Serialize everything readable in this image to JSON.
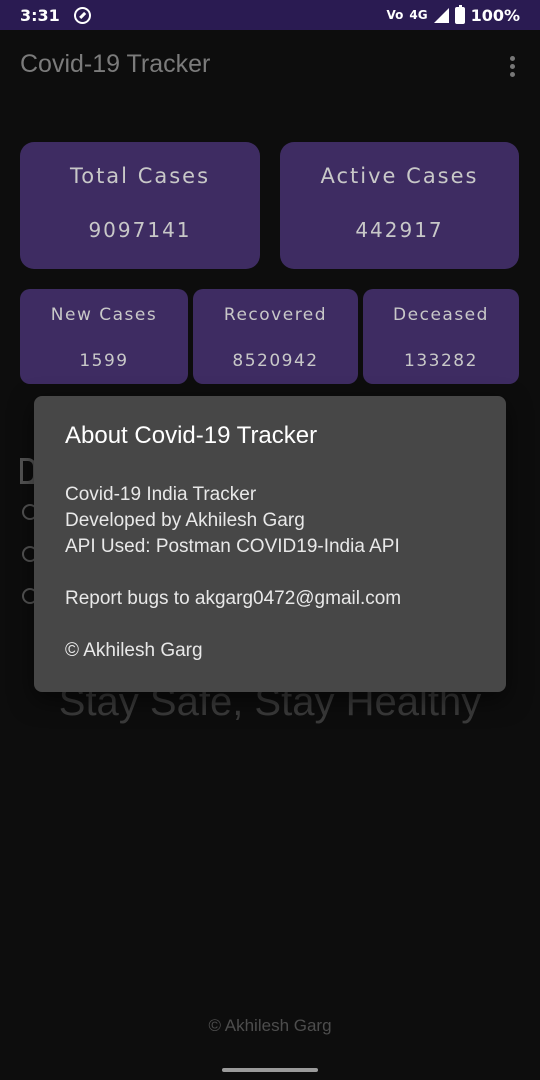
{
  "status_bar": {
    "time": "3:31",
    "volte": "Vo",
    "network": "4G",
    "battery": "100%"
  },
  "app_bar": {
    "title": "Covid-19 Tracker"
  },
  "stats": {
    "total": {
      "label": "Total Cases",
      "value": "9097141"
    },
    "active": {
      "label": "Active Cases",
      "value": "442917"
    },
    "new": {
      "label": "New Cases",
      "value": "1599"
    },
    "recovered": {
      "label": "Recovered",
      "value": "8520942"
    },
    "deceased": {
      "label": "Deceased",
      "value": "133282"
    }
  },
  "tagline": "Stay Safe, Stay Healthy",
  "footer": "© Akhilesh Garg",
  "dialog": {
    "title": "About Covid-19 Tracker",
    "line1": "Covid-19 India Tracker",
    "line2": "Developed by Akhilesh Garg",
    "line3": "API Used: Postman COVID19-India API",
    "line4": "Report bugs to akgarg0472@gmail.com",
    "line5": "© Akhilesh Garg"
  },
  "colors": {
    "card_bg": "#3e2c62",
    "status_bar_bg": "#2a1b52",
    "dialog_bg": "#474747"
  }
}
